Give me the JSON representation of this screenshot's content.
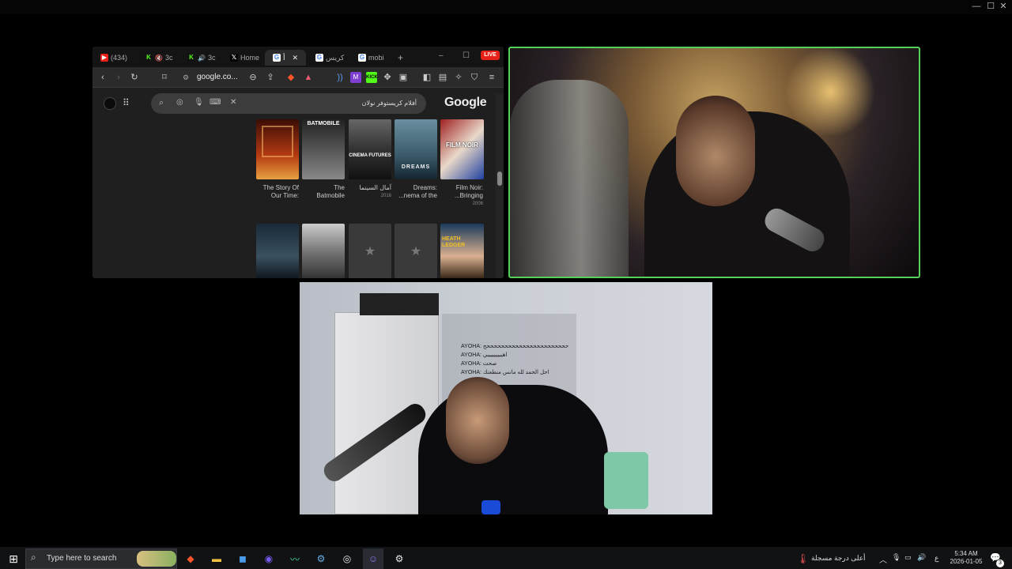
{
  "window_controls": {
    "minimize": "—",
    "maximize": "☐",
    "close": "✕"
  },
  "browser": {
    "tabs": [
      {
        "label": "(434)",
        "icon": "youtube-icon",
        "color": "#e62117"
      },
      {
        "label": "3c",
        "icon": "kick-icon",
        "color": "#53fc18"
      },
      {
        "label": "3c",
        "icon": "kick-icon",
        "color": "#53fc18"
      },
      {
        "label": "Home",
        "icon": "x-icon",
        "color": "#ffffff"
      },
      {
        "label": "أ",
        "icon": "google-icon",
        "color": "#4285f4"
      },
      {
        "label": "كريس",
        "icon": "google-icon",
        "color": "#4285f4"
      },
      {
        "label": "mobi",
        "icon": "google-icon",
        "color": "#4285f4"
      }
    ],
    "live_badge": "LIVE",
    "url": "google.co...",
    "search_query": "أفلام كريستوفر نولان",
    "google_logo": "Google",
    "films_row1": [
      {
        "title_line1": "The Story Of",
        "title_line2": "Our Time:",
        "year": ""
      },
      {
        "title_line1": "The",
        "title_line2": "Batmobile",
        "year": ""
      },
      {
        "title_line1": "آمال السينما",
        "title_line2": "",
        "year": "2016"
      },
      {
        "title_line1": "Dreams:",
        "title_line2": "...nema of the",
        "year": ""
      },
      {
        "title_line1": "Film Noir:",
        "title_line2": "...Bringing",
        "year": "2006"
      }
    ],
    "poster_texts": {
      "batmobile": "BATMOBILE",
      "cinema_futures": "CINEMA FUTURES",
      "dreams": "DREAMS",
      "film_noir": "FILM NOIR",
      "heath": "HEATH LEDGER"
    }
  },
  "cam2_chat": [
    "AYOHA: حححححححححححححححححححححححح",
    "AYOHA: اهيييييييييي",
    "AYOHA: صحت",
    "AYOHA: احل الحمد لله مانس منطعتك"
  ],
  "taskbar": {
    "search_placeholder": "Type here to search",
    "weather_text": "أعلى درجة مسجلة",
    "lang": "ع",
    "time": "5:34 AM",
    "date": "2026-01-05",
    "notifications": "3"
  }
}
